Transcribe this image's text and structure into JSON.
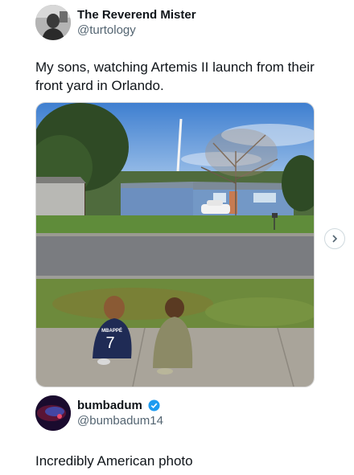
{
  "post": {
    "display_name": "The Reverend Mister",
    "handle": "@turtology",
    "text": "My sons, watching Artemis II launch from their front yard in Orlando.",
    "photo_jersey_name": "MBAPPÉ",
    "photo_jersey_number": "7"
  },
  "reply": {
    "display_name": "bumbadum",
    "handle": "@bumbadum14",
    "verified": true,
    "text": "Incredibly American photo"
  },
  "icons": {
    "next": "chevron-right-icon",
    "verified": "verified-badge-icon"
  },
  "colors": {
    "verified_blue": "#1d9bf0",
    "handle_gray": "#536471"
  }
}
